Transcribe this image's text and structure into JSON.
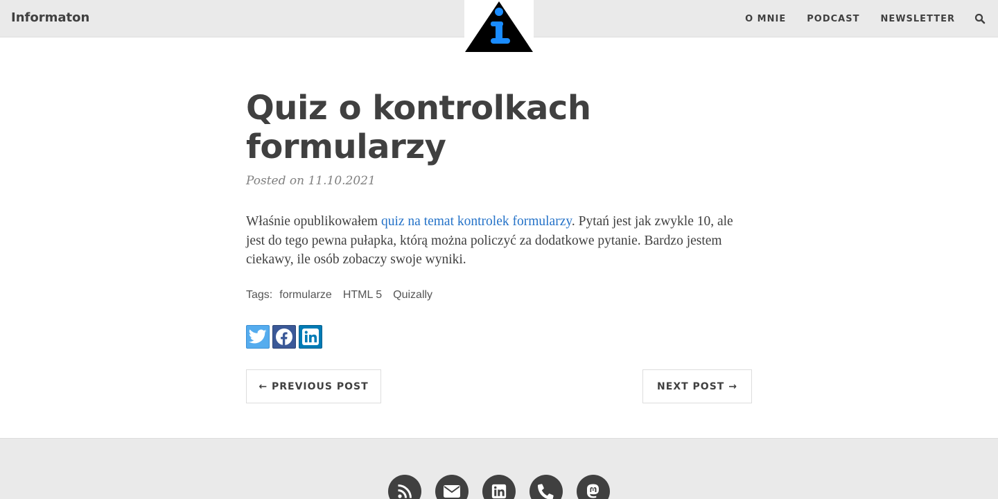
{
  "navbar": {
    "brand": "Informaton",
    "links": [
      "O MNIE",
      "PODCAST",
      "NEWSLETTER"
    ],
    "search_icon": "search-icon"
  },
  "logo": {
    "icon": "info-triangle-logo",
    "accent": "#1a8cff"
  },
  "post": {
    "title_line1": "Quiz o kontrolkach",
    "title_line2": "formularzy",
    "meta": "Posted on 11.10.2021",
    "body_before_link": "Właśnie opublikowałem ",
    "link_text": "quiz na temat kontrolek formularzy",
    "body_after_link": ". Pytań jest jak zwykle 10, ale jest do tego pewna pułapka, którą można policzyć za dodatkowe pytanie. Bardzo jestem ciekawy, ile osób zobaczy swoje wyniki.",
    "tags_label": "Tags:",
    "tags": [
      "formularze",
      "HTML 5",
      "Quizally"
    ]
  },
  "share": {
    "icons": [
      "twitter-icon",
      "facebook-icon",
      "linkedin-icon"
    ]
  },
  "pager": {
    "previous": "← PREVIOUS POST",
    "next": "NEXT POST →"
  },
  "footer": {
    "icons": [
      "rss-icon",
      "envelope-icon",
      "linkedin-icon",
      "phone-icon",
      "mastodon-icon"
    ]
  },
  "colors": {
    "navbar_bg": "#eaeaea",
    "text": "#404040",
    "link": "#2472c8",
    "twitter": "#55acee",
    "facebook": "#3b5998",
    "linkedin": "#007bb5"
  }
}
